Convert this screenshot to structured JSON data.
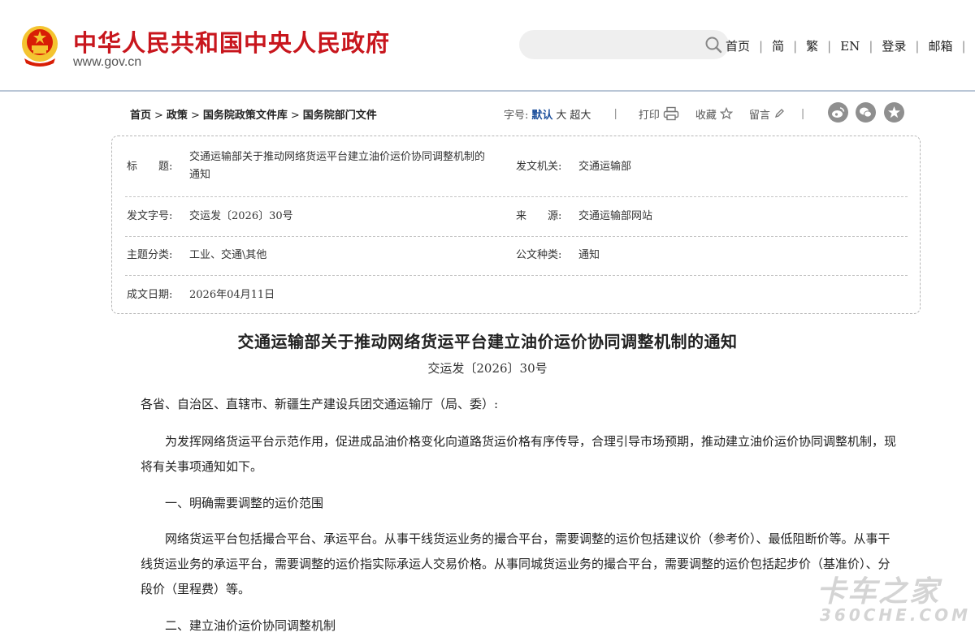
{
  "header": {
    "site_name": "中华人民共和国中央人民政府",
    "site_url": "www.gov.cn",
    "search": {
      "value": "",
      "placeholder": ""
    },
    "nav": [
      "首页",
      "简",
      "繁",
      "EN",
      "登录",
      "邮箱"
    ]
  },
  "breadcrumb": [
    "首页",
    "政策",
    "国务院政策文件库",
    "国务院部门文件"
  ],
  "toolbar": {
    "font_size_label": "字号:",
    "font_sizes": [
      "默认",
      "大",
      "超大"
    ],
    "print_label": "打印",
    "favorite_label": "收藏",
    "comment_label": "留言",
    "share_icons": [
      "weibo-icon",
      "wechat-icon",
      "qzone-icon"
    ]
  },
  "meta": {
    "title_label": "标　　题:",
    "title_line1": "交通运输部关于推动网络货运平台建立油价运价协同调整机制的",
    "title_line2": "通知",
    "issuer_label": "发文机关:",
    "issuer": "交通运输部",
    "doc_no_label": "发文字号:",
    "doc_no": "交运发〔2026〕30号",
    "source_label": "来　　源:",
    "source": "交通运输部网站",
    "category_label": "主题分类:",
    "category": "工业、交通\\其他",
    "doc_type_label": "公文种类:",
    "doc_type": "通知",
    "date_label": "成文日期:",
    "date": "2026年04月11日"
  },
  "article": {
    "title": "交通运输部关于推动网络货运平台建立油价运价协同调整机制的通知",
    "doc_number": "交运发〔2026〕30号",
    "salutation": "各省、自治区、直辖市、新疆生产建设兵团交通运输厅（局、委）:",
    "para1": "为发挥网络货运平台示范作用，促进成品油价格变化向道路货运价格有序传导，合理引导市场预期，推动建立油价运价协同调整机制，现将有关事项通知如下。",
    "heading1": "一、明确需要调整的运价范围",
    "para2": "网络货运平台包括撮合平台、承运平台。从事干线货运业务的撮合平台，需要调整的运价包括建议价（参考价）、最低阻断价等。从事干线货运业务的承运平台，需要调整的运价指实际承运人交易价格。从事同城货运业务的撮合平台，需要调整的运价包括起步价（基准价）、分段价（里程费）等。",
    "heading2": "二、建立油价运价协同调整机制"
  },
  "watermark": {
    "cn": "卡车之家",
    "en": "360CHE.COM"
  },
  "colors": {
    "brand_red": "#c8161d",
    "emblem_gold": "#f4c430",
    "active_blue": "#1c4f9c"
  }
}
